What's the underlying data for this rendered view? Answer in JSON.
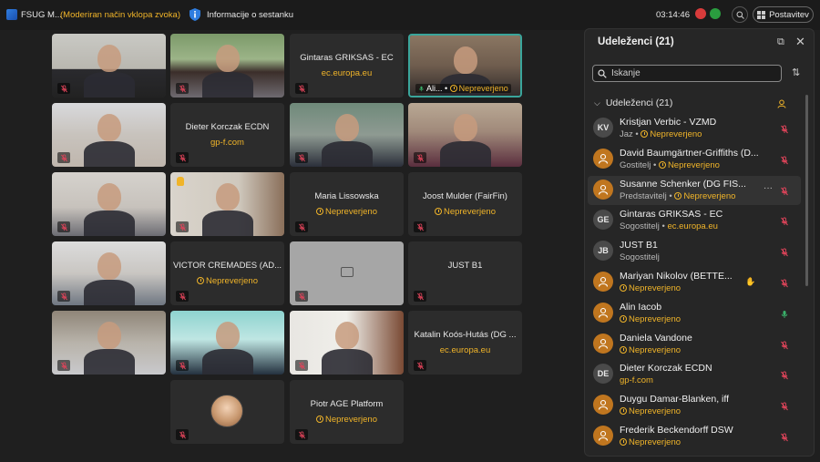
{
  "topbar": {
    "app_title": "FSUG M...",
    "mode": "(Moderiran način vklopa zvoka)",
    "info_label": "Informacije o sestanku",
    "clock": "03:14:46",
    "layout_label": "Postavitev"
  },
  "tiles": [
    {
      "id": "t1",
      "kind": "video",
      "muted": true
    },
    {
      "id": "t2",
      "kind": "video",
      "muted": true
    },
    {
      "id": "t3",
      "kind": "name",
      "name": "Gintaras GRIKSAS - EC",
      "sub": "ec.europa.eu",
      "sub_type": "domain",
      "muted": true
    },
    {
      "id": "t4",
      "kind": "video",
      "active": true,
      "label": "Ali...",
      "sub": "Nepreverjeno"
    },
    {
      "id": "t5",
      "kind": "video",
      "muted": true
    },
    {
      "id": "t6",
      "kind": "name",
      "name": "Dieter Korczak ECDN",
      "sub": "gp-f.com",
      "sub_type": "domain",
      "muted": true
    },
    {
      "id": "t7",
      "kind": "video",
      "muted": true
    },
    {
      "id": "t8",
      "kind": "video",
      "muted": true
    },
    {
      "id": "t9",
      "kind": "video",
      "muted": true
    },
    {
      "id": "t10",
      "kind": "video",
      "muted": true
    },
    {
      "id": "t11",
      "kind": "name",
      "name": "Maria Lissowska",
      "sub": "Nepreverjeno",
      "sub_type": "warn",
      "muted": true
    },
    {
      "id": "t12",
      "kind": "name",
      "name": "Joost Mulder (FairFin)",
      "sub": "Nepreverjeno",
      "sub_type": "warn",
      "muted": true
    },
    {
      "id": "t13",
      "kind": "video",
      "muted": true
    },
    {
      "id": "t14",
      "kind": "name",
      "name": "VICTOR CREMADES (AD...",
      "sub": "Nepreverjeno",
      "sub_type": "warn",
      "muted": true
    },
    {
      "id": "t15",
      "kind": "blank",
      "muted": true
    },
    {
      "id": "t16",
      "kind": "name",
      "name": "JUST B1",
      "sub": "",
      "sub_type": "none",
      "muted": true
    },
    {
      "id": "t17",
      "kind": "video",
      "muted": true
    },
    {
      "id": "t18",
      "kind": "video",
      "muted": true
    },
    {
      "id": "t19",
      "kind": "video",
      "muted": true
    },
    {
      "id": "t20",
      "kind": "name",
      "name": "Katalin Koós-Hutás (DG ...",
      "sub": "ec.europa.eu",
      "sub_type": "domain",
      "muted": true
    },
    {
      "id": "t21",
      "kind": "avatar",
      "muted": true
    },
    {
      "id": "t22",
      "kind": "name",
      "name": "Piotr AGE Platform",
      "sub": "Nepreverjeno",
      "sub_type": "warn",
      "muted": true
    }
  ],
  "panel": {
    "title": "Udeleženci (21)",
    "search_placeholder": "Iskanje",
    "section_label": "Udeleženci (21)",
    "participants": [
      {
        "name": "Kristjan Verbic - VZMD",
        "role": "Jaz",
        "tag": "Nepreverjeno",
        "avatar": "KV",
        "avatar_type": "initials",
        "mic": "muted"
      },
      {
        "name": "David Baumgärtner-Griffiths (D...",
        "role": "Gostitelj",
        "tag": "Nepreverjeno",
        "avatar": "",
        "avatar_type": "person",
        "mic": "muted"
      },
      {
        "name": "Susanne Schenker (DG FIS...",
        "role": "Predstavitelj",
        "tag": "Nepreverjeno",
        "avatar": "",
        "avatar_type": "person",
        "mic": "muted",
        "highlight": true
      },
      {
        "name": "Gintaras GRIKSAS - EC",
        "role": "Sogostitelj",
        "tag": "ec.europa.eu",
        "tag_type": "domain",
        "avatar": "GE",
        "avatar_type": "initials",
        "mic": "muted"
      },
      {
        "name": "JUST B1",
        "role": "Sogostitelj",
        "tag": "",
        "avatar": "JB",
        "avatar_type": "initials",
        "mic": "muted"
      },
      {
        "name": "Mariyan Nikolov (BETTE...",
        "role": "",
        "tag": "Nepreverjeno",
        "avatar": "",
        "avatar_type": "person",
        "mic": "muted",
        "hand": true
      },
      {
        "name": "Alin Iacob",
        "role": "",
        "tag": "Nepreverjeno",
        "avatar": "",
        "avatar_type": "person",
        "mic": "active"
      },
      {
        "name": "Daniela Vandone",
        "role": "",
        "tag": "Nepreverjeno",
        "avatar": "",
        "avatar_type": "person",
        "mic": "muted"
      },
      {
        "name": "Dieter Korczak ECDN",
        "role": "",
        "tag": "gp-f.com",
        "tag_type": "domain",
        "avatar": "DE",
        "avatar_type": "initials",
        "mic": "muted"
      },
      {
        "name": "Duygu Damar-Blanken, iff",
        "role": "",
        "tag": "Nepreverjeno",
        "avatar": "",
        "avatar_type": "person",
        "mic": "muted"
      },
      {
        "name": "Frederik Beckendorff DSW",
        "role": "",
        "tag": "Nepreverjeno",
        "avatar": "",
        "avatar_type": "person",
        "mic": "muted"
      }
    ]
  },
  "colors": {
    "accent": "#3aa59b",
    "warning": "#f0b429",
    "muted_mic": "#e0445a",
    "active_mic": "#3ab36b"
  }
}
